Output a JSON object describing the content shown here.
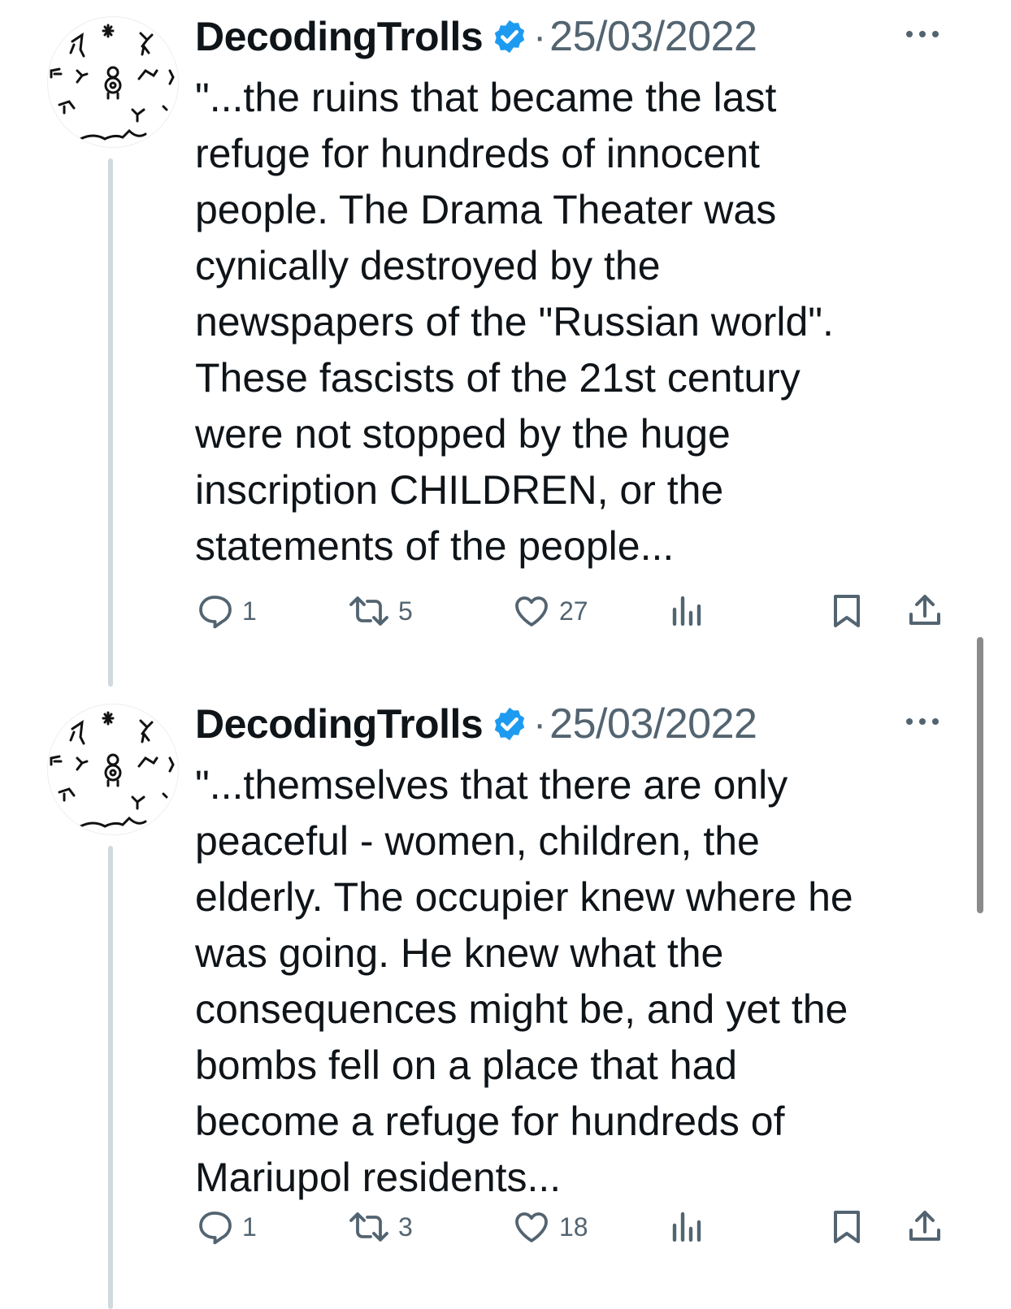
{
  "tweets": [
    {
      "author": "DecodingTrolls",
      "separator": "·",
      "date": "25/03/2022",
      "lines": [
        "\"...the ruins that became the last",
        "refuge for hundreds of innocent",
        "people. The Drama Theater was",
        "cynically destroyed by the",
        "newspapers of the \"Russian world\".",
        "These fascists of the 21st century",
        "were not stopped by the huge",
        "inscription CHILDREN, or the",
        "statements of the people..."
      ],
      "replies": "1",
      "reposts": "5",
      "likes": "27"
    },
    {
      "author": "DecodingTrolls",
      "separator": "·",
      "date": "25/03/2022",
      "lines": [
        "\"...themselves that there are only",
        "peaceful - women, children, the",
        "elderly. The occupier knew where he",
        "was going. He knew what the",
        "consequences might be, and yet the",
        "bombs fell on a place that had",
        "become a refuge for hundreds of",
        "Mariupol residents..."
      ],
      "replies": "1",
      "reposts": "3",
      "likes": "18"
    }
  ],
  "icons": {
    "verified": "verified-badge-icon",
    "more": "more-options-icon",
    "reply": "reply-icon",
    "repost": "repost-icon",
    "like": "like-icon",
    "views": "views-icon",
    "bookmark": "bookmark-icon",
    "share": "share-icon"
  },
  "colors": {
    "verified_blue": "#1d9bf0",
    "secondary_text": "#536471",
    "thread_line": "#cfd9de"
  }
}
